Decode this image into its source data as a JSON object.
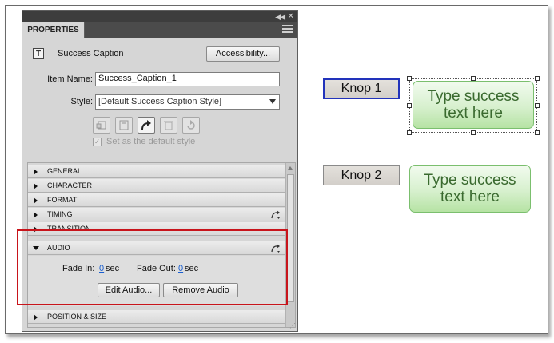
{
  "panel": {
    "tab_label": "PROPERTIES",
    "object_type": "Success Caption",
    "accessibility_button": "Accessibility...",
    "item_name_label": "Item Name:",
    "item_name_value": "Success_Caption_1",
    "style_label": "Style:",
    "style_value": "[Default Success Caption Style]",
    "style_toolbar_icons": [
      "new-style-icon",
      "save-style-icon",
      "redo-icon",
      "delete-icon",
      "reset-icon"
    ],
    "default_style_label": "Set as the default style",
    "default_style_checked": true,
    "sections": [
      {
        "label": "GENERAL"
      },
      {
        "label": "CHARACTER"
      },
      {
        "label": "FORMAT"
      },
      {
        "label": "TIMING"
      },
      {
        "label": "TRANSITION"
      },
      {
        "label": "AUDIO"
      },
      {
        "label": "POSITION & SIZE"
      }
    ],
    "audio": {
      "fade_in_label": "Fade In:",
      "fade_in_value": "0",
      "fade_in_unit": "sec",
      "fade_out_label": "Fade Out:",
      "fade_out_value": "0",
      "fade_out_unit": "sec",
      "edit_button": "Edit Audio...",
      "remove_button": "Remove Audio"
    }
  },
  "stage": {
    "button1": "Knop 1",
    "button2": "Knop 2",
    "caption1_line1": "Type success",
    "caption1_line2": "text here",
    "caption2_line1": "Type success",
    "caption2_line2": "text here"
  },
  "colors": {
    "highlight": "#c8141b",
    "selected_button_border": "#2233bb",
    "caption_text": "#3a6a2f",
    "link_value": "#1a5fd0"
  }
}
